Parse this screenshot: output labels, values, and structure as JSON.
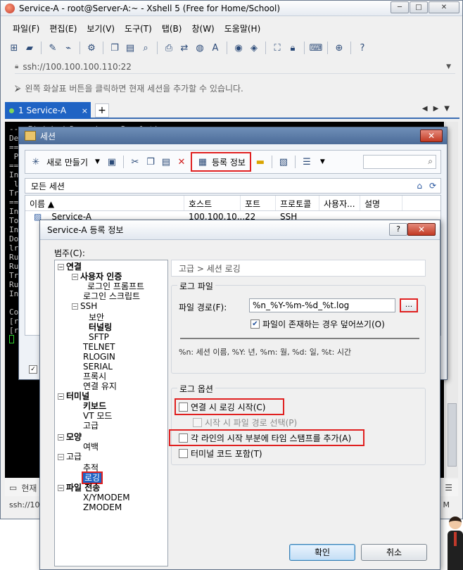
{
  "app": {
    "title": "Service-A - root@Server-A:~ - Xshell 5 (Free for Home/School)",
    "window_buttons": [
      "─",
      "□",
      "✕"
    ]
  },
  "menu": [
    "파일(F)",
    "편집(E)",
    "보기(V)",
    "도구(T)",
    "탭(B)",
    "창(W)",
    "도움말(H)"
  ],
  "address": "ssh://100.100.100.110:22",
  "hint": "왼쪽 화살표 버튼을 클릭하면 현재 세션을 추가할 수 있습니다.",
  "tab": {
    "label": "1 Service-A",
    "close": "×",
    "add": "+",
    "nav": "◀▶▼"
  },
  "terminal": {
    "lines": [
      "--> Finished Dependency Resolution",
      "",
      "De",
      "",
      "==",
      " P",
      "==",
      "In",
      " l",
      "",
      "Tr",
      "==",
      "In",
      "",
      "To",
      "In",
      "Do",
      "lr",
      "Ru",
      "Ru",
      "Tr",
      "Ru",
      "",
      "",
      "",
      "",
      "",
      "",
      "Instal",
      "  lrzs",
      "",
      "Comple",
      "[root@",
      "[root@"
    ]
  },
  "status": {
    "bar1": "현재",
    "bar2_left": "ssh://100",
    "bar2_right": "M"
  },
  "session_dialog": {
    "title": "세션",
    "close": "✕",
    "new_label": "새로 만들기",
    "properties_label": "등록 정보",
    "path": "모든 세션",
    "headers": [
      "이름 ▲",
      "호스트",
      "포트",
      "프로토콜",
      "사용자...",
      "설명"
    ],
    "rows": [
      {
        "name": "Service-A",
        "host": "100.100.10...",
        "port": "22",
        "protocol": "SSH",
        "user": "",
        "desc": ""
      }
    ],
    "check": "✓"
  },
  "prop_dialog": {
    "title": "Service-A 등록 정보",
    "help": "?",
    "close": "✕",
    "category_label": "범주(C):",
    "tree": [
      {
        "label": "연결",
        "pm": "−",
        "bold": true
      },
      {
        "label": "사용자 인증",
        "pm": "−",
        "bold": true
      },
      {
        "label": "로그인 프롬프트"
      },
      {
        "label": "로그인 스크립트"
      },
      {
        "label": "SSH",
        "pm": "−"
      },
      {
        "label": "보안"
      },
      {
        "label": "터널링",
        "bold": true
      },
      {
        "label": "SFTP"
      },
      {
        "label": "TELNET"
      },
      {
        "label": "RLOGIN"
      },
      {
        "label": "SERIAL"
      },
      {
        "label": "프록시"
      },
      {
        "label": "연결 유지"
      },
      {
        "label": "터미널",
        "pm": "−",
        "bold": true
      },
      {
        "label": "키보드",
        "bold": true
      },
      {
        "label": "VT 모드"
      },
      {
        "label": "고급"
      },
      {
        "label": "모양",
        "pm": "−",
        "bold": true
      },
      {
        "label": "여백"
      },
      {
        "label": "고급",
        "pm": "−"
      },
      {
        "label": "추적"
      },
      {
        "label": "로깅",
        "selected": true
      },
      {
        "label": "파일 전송",
        "pm": "−",
        "bold": true
      },
      {
        "label": "X/YMODEM"
      },
      {
        "label": "ZMODEM"
      }
    ],
    "breadcrumb": "고급 > 세션 로깅",
    "log_file_group": "로그 파일",
    "file_path_label": "파일 경로(F):",
    "file_path_value": "%n_%Y-%m-%d_%t.log",
    "browse": "...",
    "overwrite_label": "파일이 존재하는 경우 덮어쓰기(O)",
    "overwrite_checked": true,
    "legend": "%n: 세션 이름, %Y: 년, %m: 월, %d: 일, %t: 시간",
    "log_options_group": "로그 옵션",
    "options": [
      {
        "label": "연결 시 로깅 시작(C)",
        "checked": false,
        "disabled": false
      },
      {
        "label": "시작 시 파일 경로 선택(P)",
        "checked": false,
        "disabled": true
      },
      {
        "label": "각 라인의 시작 부분에 타임 스탬프를 추가(A)",
        "checked": false,
        "disabled": false
      },
      {
        "label": "터미널 코드 포함(T)",
        "checked": false,
        "disabled": false
      }
    ],
    "ok": "확인",
    "cancel": "취소"
  }
}
